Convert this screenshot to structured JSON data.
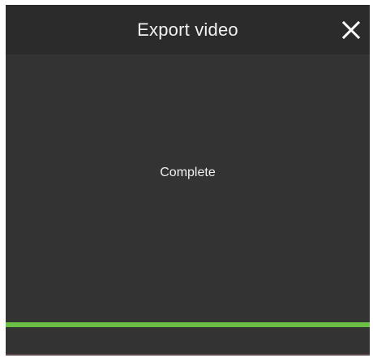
{
  "dialog": {
    "title": "Export video",
    "close_icon": "close-icon"
  },
  "status": {
    "text": "Complete"
  },
  "progress": {
    "percent": 100,
    "color": "#6cbf45"
  },
  "colors": {
    "header_bg": "#2b2b2b",
    "dialog_bg": "#333333"
  }
}
